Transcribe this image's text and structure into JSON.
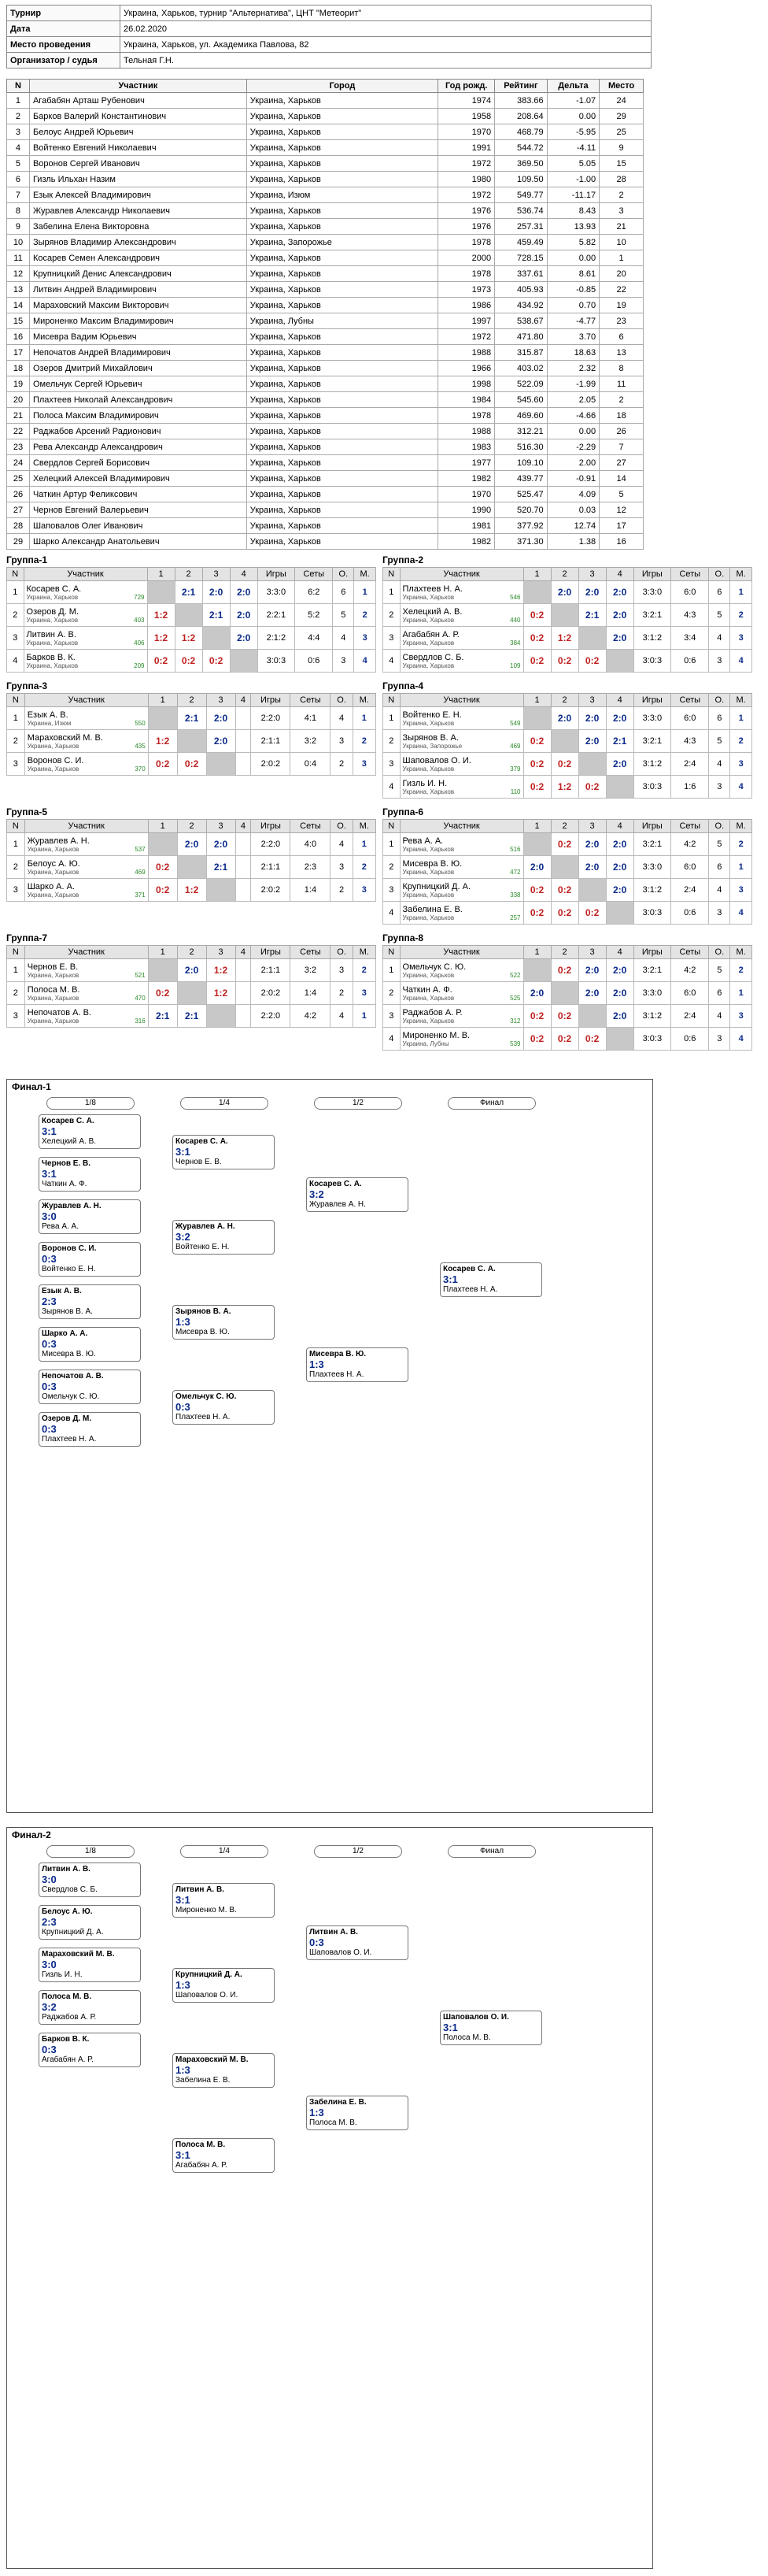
{
  "info": [
    {
      "k": "Турнир",
      "v": "Украина, Харьков, турнир \"Альтернатива\", ЦНТ \"Метеорит\""
    },
    {
      "k": "Дата",
      "v": "26.02.2020"
    },
    {
      "k": "Место проведения",
      "v": "Украина, Харьков, ул. Академика Павлова, 82"
    },
    {
      "k": "Организатор / судья",
      "v": "Тельная Г.Н."
    }
  ],
  "plist_headers": [
    "N",
    "Участник",
    "Город",
    "Год рожд.",
    "Рейтинг",
    "Дельта",
    "Место"
  ],
  "players": [
    [
      "1",
      "Агабабян Арташ Рубенович",
      "Украина, Харьков",
      "1974",
      "383.66",
      "-1.07",
      "24"
    ],
    [
      "2",
      "Барков Валерий Константинович",
      "Украина, Харьков",
      "1958",
      "208.64",
      "0.00",
      "29"
    ],
    [
      "3",
      "Белоус Андрей Юрьевич",
      "Украина, Харьков",
      "1970",
      "468.79",
      "-5.95",
      "25"
    ],
    [
      "4",
      "Войтенко Евгений Николаевич",
      "Украина, Харьков",
      "1991",
      "544.72",
      "-4.11",
      "9"
    ],
    [
      "5",
      "Воронов Сергей Иванович",
      "Украина, Харьков",
      "1972",
      "369.50",
      "5.05",
      "15"
    ],
    [
      "6",
      "Гизль Ильхан Назим",
      "Украина, Харьков",
      "1980",
      "109.50",
      "-1.00",
      "28"
    ],
    [
      "7",
      "Езык Алексей Владимирович",
      "Украина, Изюм",
      "1972",
      "549.77",
      "-11.17",
      "2"
    ],
    [
      "8",
      "Журавлев Александр Николаевич",
      "Украина, Харьков",
      "1976",
      "536.74",
      "8.43",
      "3"
    ],
    [
      "9",
      "Забелина Елена Викторовна",
      "Украина, Харьков",
      "1976",
      "257.31",
      "13.93",
      "21"
    ],
    [
      "10",
      "Зырянов Владимир Александрович",
      "Украина, Запорожье",
      "1978",
      "459.49",
      "5.82",
      "10"
    ],
    [
      "11",
      "Косарев Семен Александрович",
      "Украина, Харьков",
      "2000",
      "728.15",
      "0.00",
      "1"
    ],
    [
      "12",
      "Крупницкий Денис Александрович",
      "Украина, Харьков",
      "1978",
      "337.61",
      "8.61",
      "20"
    ],
    [
      "13",
      "Литвин Андрей Владимирович",
      "Украина, Харьков",
      "1973",
      "405.93",
      "-0.85",
      "22"
    ],
    [
      "14",
      "Мараховский Максим Викторович",
      "Украина, Харьков",
      "1986",
      "434.92",
      "0.70",
      "19"
    ],
    [
      "15",
      "Мироненко Максим Владимирович",
      "Украина, Лубны",
      "1997",
      "538.67",
      "-4.77",
      "23"
    ],
    [
      "16",
      "Мисевра Вадим Юрьевич",
      "Украина, Харьков",
      "1972",
      "471.80",
      "3.70",
      "6"
    ],
    [
      "17",
      "Непочатов Андрей Владимирович",
      "Украина, Харьков",
      "1988",
      "315.87",
      "18.63",
      "13"
    ],
    [
      "18",
      "Озеров Дмитрий Михайлович",
      "Украина, Харьков",
      "1966",
      "403.02",
      "2.32",
      "8"
    ],
    [
      "19",
      "Омельчук Сергей Юрьевич",
      "Украина, Харьков",
      "1998",
      "522.09",
      "-1.99",
      "11"
    ],
    [
      "20",
      "Плахтеев Николай Александрович",
      "Украина, Харьков",
      "1984",
      "545.60",
      "2.05",
      "2"
    ],
    [
      "21",
      "Полоса Максим Владимирович",
      "Украина, Харьков",
      "1978",
      "469.60",
      "-4.66",
      "18"
    ],
    [
      "22",
      "Раджабов Арсений Радионович",
      "Украина, Харьков",
      "1988",
      "312.21",
      "0.00",
      "26"
    ],
    [
      "23",
      "Рева Александр Александрович",
      "Украина, Харьков",
      "1983",
      "516.30",
      "-2.29",
      "7"
    ],
    [
      "24",
      "Свердлов Сергей Борисович",
      "Украина, Харьков",
      "1977",
      "109.10",
      "2.00",
      "27"
    ],
    [
      "25",
      "Хелецкий Алексей Владимирович",
      "Украина, Харьков",
      "1982",
      "439.77",
      "-0.91",
      "14"
    ],
    [
      "26",
      "Чаткин Артур Феликсович",
      "Украина, Харьков",
      "1970",
      "525.47",
      "4.09",
      "5"
    ],
    [
      "27",
      "Чернов Евгений Валерьевич",
      "Украина, Харьков",
      "1990",
      "520.70",
      "0.03",
      "12"
    ],
    [
      "28",
      "Шаповалов Олег Иванович",
      "Украина, Харьков",
      "1981",
      "377.92",
      "12.74",
      "17"
    ],
    [
      "29",
      "Шарко Александр Анатольевич",
      "Украина, Харьков",
      "1982",
      "371.30",
      "1.38",
      "16"
    ]
  ],
  "group_headers": [
    "N",
    "Участник",
    "1",
    "2",
    "3",
    "4",
    "Игры",
    "Сеты",
    "О.",
    "М."
  ],
  "groups": [
    {
      "title": "Группа-1",
      "rows": [
        [
          "1",
          "Косарев С. А.",
          "Украина, Харьков",
          "729",
          "",
          "2:1",
          "2:0",
          "2:0",
          "3:3:0",
          "6:2",
          "6",
          "1"
        ],
        [
          "2",
          "Озеров Д. М.",
          "Украина, Харьков",
          "403",
          "1:2",
          "",
          "2:1",
          "2:0",
          "2:2:1",
          "5:2",
          "5",
          "2"
        ],
        [
          "3",
          "Литвин А. В.",
          "Украина, Харьков",
          "406",
          "1:2",
          "1:2",
          "",
          "2:0",
          "2:1:2",
          "4:4",
          "4",
          "3"
        ],
        [
          "4",
          "Барков В. К.",
          "Украина, Харьков",
          "209",
          "0:2",
          "0:2",
          "0:2",
          "",
          "3:0:3",
          "0:6",
          "3",
          "4"
        ]
      ]
    },
    {
      "title": "Группа-2",
      "rows": [
        [
          "1",
          "Плахтеев Н. А.",
          "Украина, Харьков",
          "546",
          "",
          "2:0",
          "2:0",
          "2:0",
          "3:3:0",
          "6:0",
          "6",
          "1"
        ],
        [
          "2",
          "Хелецкий А. В.",
          "Украина, Харьков",
          "440",
          "0:2",
          "",
          "2:1",
          "2:0",
          "3:2:1",
          "4:3",
          "5",
          "2"
        ],
        [
          "3",
          "Агабабян А. Р.",
          "Украина, Харьков",
          "384",
          "0:2",
          "1:2",
          "",
          "2:0",
          "3:1:2",
          "3:4",
          "4",
          "3"
        ],
        [
          "4",
          "Свердлов С. Б.",
          "Украина, Харьков",
          "109",
          "0:2",
          "0:2",
          "0:2",
          "",
          "3:0:3",
          "0:6",
          "3",
          "4"
        ]
      ]
    },
    {
      "title": "Группа-3",
      "rows": [
        [
          "1",
          "Езык А. В.",
          "Украина, Изюм",
          "550",
          "",
          "2:1",
          "2:0",
          "",
          "2:2:0",
          "4:1",
          "4",
          "1"
        ],
        [
          "2",
          "Мараховский М. В.",
          "Украина, Харьков",
          "435",
          "1:2",
          "",
          "2:0",
          "",
          "2:1:1",
          "3:2",
          "3",
          "2"
        ],
        [
          "3",
          "Воронов С. И.",
          "Украина, Харьков",
          "370",
          "0:2",
          "0:2",
          "",
          "",
          "2:0:2",
          "0:4",
          "2",
          "3"
        ]
      ]
    },
    {
      "title": "Группа-4",
      "rows": [
        [
          "1",
          "Войтенко Е. Н.",
          "Украина, Харьков",
          "549",
          "",
          "2:0",
          "2:0",
          "2:0",
          "3:3:0",
          "6:0",
          "6",
          "1"
        ],
        [
          "2",
          "Зырянов В. А.",
          "Украина, Запорожье",
          "469",
          "0:2",
          "",
          "2:0",
          "2:1",
          "3:2:1",
          "4:3",
          "5",
          "2"
        ],
        [
          "3",
          "Шаповалов О. И.",
          "Украина, Харьков",
          "379",
          "0:2",
          "0:2",
          "",
          "2:0",
          "3:1:2",
          "2:4",
          "4",
          "3"
        ],
        [
          "4",
          "Гизль И. Н.",
          "Украина, Харьков",
          "110",
          "0:2",
          "1:2",
          "0:2",
          "",
          "3:0:3",
          "1:6",
          "3",
          "4"
        ]
      ]
    },
    {
      "title": "Группа-5",
      "rows": [
        [
          "1",
          "Журавлев А. Н.",
          "Украина, Харьков",
          "537",
          "",
          "2:0",
          "2:0",
          "",
          "2:2:0",
          "4:0",
          "4",
          "1"
        ],
        [
          "2",
          "Белоус А. Ю.",
          "Украина, Харьков",
          "469",
          "0:2",
          "",
          "2:1",
          "",
          "2:1:1",
          "2:3",
          "3",
          "2"
        ],
        [
          "3",
          "Шарко А. А.",
          "Украина, Харьков",
          "371",
          "0:2",
          "1:2",
          "",
          "",
          "2:0:2",
          "1:4",
          "2",
          "3"
        ]
      ]
    },
    {
      "title": "Группа-6",
      "rows": [
        [
          "1",
          "Рева А. А.",
          "Украина, Харьков",
          "516",
          "",
          "0:2",
          "2:0",
          "2:0",
          "3:2:1",
          "4:2",
          "5",
          "2"
        ],
        [
          "2",
          "Мисевра В. Ю.",
          "Украина, Харьков",
          "472",
          "2:0",
          "",
          "2:0",
          "2:0",
          "3:3:0",
          "6:0",
          "6",
          "1"
        ],
        [
          "3",
          "Крупницкий Д. А.",
          "Украина, Харьков",
          "338",
          "0:2",
          "0:2",
          "",
          "2:0",
          "3:1:2",
          "2:4",
          "4",
          "3"
        ],
        [
          "4",
          "Забелина Е. В.",
          "Украина, Харьков",
          "257",
          "0:2",
          "0:2",
          "0:2",
          "",
          "3:0:3",
          "0:6",
          "3",
          "4"
        ]
      ]
    },
    {
      "title": "Группа-7",
      "rows": [
        [
          "1",
          "Чернов Е. В.",
          "Украина, Харьков",
          "521",
          "",
          "2:0",
          "1:2",
          "",
          "2:1:1",
          "3:2",
          "3",
          "2"
        ],
        [
          "2",
          "Полоса М. В.",
          "Украина, Харьков",
          "470",
          "0:2",
          "",
          "1:2",
          "",
          "2:0:2",
          "1:4",
          "2",
          "3"
        ],
        [
          "3",
          "Непочатов А. В.",
          "Украина, Харьков",
          "316",
          "2:1",
          "2:1",
          "",
          "",
          "2:2:0",
          "4:2",
          "4",
          "1"
        ]
      ]
    },
    {
      "title": "Группа-8",
      "rows": [
        [
          "1",
          "Омельчук С. Ю.",
          "Украина, Харьков",
          "522",
          "",
          "0:2",
          "2:0",
          "2:0",
          "3:2:1",
          "4:2",
          "5",
          "2"
        ],
        [
          "2",
          "Чаткин А. Ф.",
          "Украина, Харьков",
          "525",
          "2:0",
          "",
          "2:0",
          "2:0",
          "3:3:0",
          "6:0",
          "6",
          "1"
        ],
        [
          "3",
          "Раджабов А. Р.",
          "Украина, Харьков",
          "312",
          "0:2",
          "0:2",
          "",
          "2:0",
          "3:1:2",
          "2:4",
          "4",
          "3"
        ],
        [
          "4",
          "Мироненко М. В.",
          "Украина, Лубны",
          "539",
          "0:2",
          "0:2",
          "0:2",
          "",
          "3:0:3",
          "0:6",
          "3",
          "4"
        ]
      ]
    }
  ],
  "final1": {
    "title": "Финал-1",
    "rounds": [
      "1/8",
      "1/4",
      "1/2",
      "Финал"
    ],
    "m18": [
      {
        "a": "Косарев С. А.",
        "b": "Хелецкий А. В.",
        "s": "3:1"
      },
      {
        "a": "Чернов Е. В.",
        "b": "Чаткин А. Ф.",
        "s": "3:1"
      },
      {
        "a": "Журавлев А. Н.",
        "b": "Рева А. А.",
        "s": "3:0"
      },
      {
        "a": "Воронов С. И.",
        "b": "Войтенко Е. Н.",
        "s": "0:3"
      },
      {
        "a": "Езык А. В.",
        "b": "Зырянов В. А.",
        "s": "2:3"
      },
      {
        "a": "Шарко А. А.",
        "b": "Мисевра В. Ю.",
        "s": "0:3"
      },
      {
        "a": "Непочатов А. В.",
        "b": "Омельчук С. Ю.",
        "s": "0:3"
      },
      {
        "a": "Озеров Д. М.",
        "b": "Плахтеев Н. А.",
        "s": "0:3"
      }
    ],
    "m14": [
      {
        "a": "Косарев С. А.",
        "b": "Чернов Е. В.",
        "s": "3:1"
      },
      {
        "a": "Журавлев А. Н.",
        "b": "Войтенко Е. Н.",
        "s": "3:2"
      },
      {
        "a": "Зырянов В. А.",
        "b": "Мисевра В. Ю.",
        "s": "1:3"
      },
      {
        "a": "Омельчук С. Ю.",
        "b": "Плахтеев Н. А.",
        "s": "0:3"
      }
    ],
    "m12": [
      {
        "a": "Косарев С. А.",
        "b": "Журавлев А. Н.",
        "s": "3:2"
      },
      {
        "a": "Мисевра В. Ю.",
        "b": "Плахтеев Н. А.",
        "s": "1:3"
      }
    ],
    "mf": {
      "a": "Косарев С. А.",
      "b": "Плахтеев Н. А.",
      "s": "3:1"
    }
  },
  "final2": {
    "title": "Финал-2",
    "rounds": [
      "1/8",
      "1/4",
      "1/2",
      "Финал"
    ],
    "m18": [
      {
        "a": "Литвин А. В.",
        "b": "Свердлов С. Б.",
        "s": "3:0"
      },
      {
        "a": "Белоус А. Ю.",
        "b": "Крупницкий Д. А.",
        "s": "2:3"
      },
      {
        "a": "Мараховский М. В.",
        "b": "Гизль И. Н.",
        "s": "3:0"
      },
      {
        "a": "Полоса М. В.",
        "b": "Раджабов А. Р.",
        "s": "3:2"
      },
      {
        "a": "Барков В. К.",
        "b": "Агабабян А. Р.",
        "s": "0:3"
      }
    ],
    "m14": [
      {
        "a": "Литвин А. В.",
        "b": "Мироненко М. В.",
        "s": "3:1"
      },
      {
        "a": "Крупницкий Д. А.",
        "b": "Шаповалов О. И.",
        "s": "1:3"
      },
      {
        "a": "Мараховский М. В.",
        "b": "Забелина Е. В.",
        "s": "1:3"
      },
      {
        "a": "Полоса М. В.",
        "b": "Агабабян А. Р.",
        "s": "3:1"
      }
    ],
    "m12": [
      {
        "a": "Литвин А. В.",
        "b": "Шаповалов О. И.",
        "s": "0:3"
      },
      {
        "a": "Забелина Е. В.",
        "b": "Полоса М. В.",
        "s": "1:3"
      }
    ],
    "mf": {
      "a": "Шаповалов О. И.",
      "b": "Полоса М. В.",
      "s": "3:1"
    }
  }
}
